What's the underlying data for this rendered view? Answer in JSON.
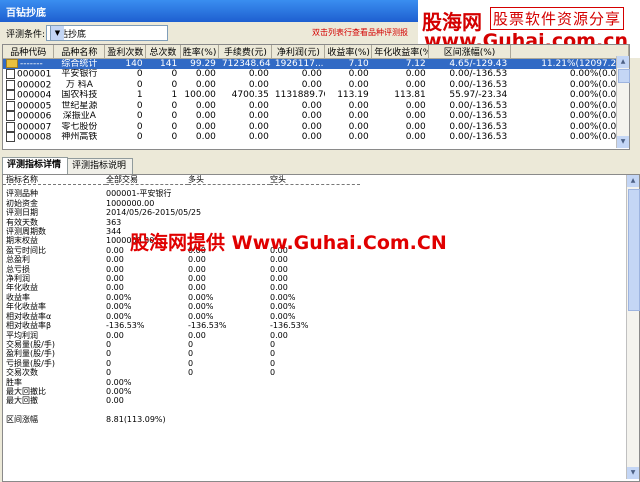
{
  "window": {
    "title": "百钻抄底"
  },
  "brand": {
    "logo": "股海网",
    "slogan": "股票软件资源分享",
    "url": "www.Guhai.com.cn"
  },
  "condition": {
    "label": "评测条件:",
    "value": "百钻抄底",
    "hint": "双击列表行查看品种评测报"
  },
  "grid": {
    "headers": [
      "品种代码",
      "品种名称",
      "盈利次数",
      "总次数",
      "胜率(%)",
      "手续费(元)",
      "净利润(元)",
      "收益率(%)",
      "年化收益率(%)",
      "区间涨幅(%)",
      ""
    ],
    "rows": [
      [
        "-------",
        "综合统计",
        "140",
        "141",
        "99.29",
        "712348.64",
        "1926117...",
        "7.10",
        "7.12",
        "4.65/-129.43",
        "11.21%(12097.25)"
      ],
      [
        "000001",
        "平安银行",
        "0",
        "0",
        "0.00",
        "0.00",
        "0.00",
        "0.00",
        "0.00",
        "0.00/-136.53",
        "0.00%(0.00)"
      ],
      [
        "000002",
        "万  科A",
        "0",
        "0",
        "0.00",
        "0.00",
        "0.00",
        "0.00",
        "0.00",
        "0.00/-136.53",
        "0.00%(0.00)"
      ],
      [
        "000004",
        "国农科技",
        "1",
        "1",
        "100.00",
        "4700.35",
        "1131889.76",
        "113.19",
        "113.81",
        "55.97/-23.34",
        "0.00%(0.00)"
      ],
      [
        "000005",
        "世纪星源",
        "0",
        "0",
        "0.00",
        "0.00",
        "0.00",
        "0.00",
        "0.00",
        "0.00/-136.53",
        "0.00%(0.00)"
      ],
      [
        "000006",
        "深振业A",
        "0",
        "0",
        "0.00",
        "0.00",
        "0.00",
        "0.00",
        "0.00",
        "0.00/-136.53",
        "0.00%(0.00)"
      ],
      [
        "000007",
        "零七股份",
        "0",
        "0",
        "0.00",
        "0.00",
        "0.00",
        "0.00",
        "0.00",
        "0.00/-136.53",
        "0.00%(0.00)"
      ],
      [
        "000008",
        "神州高铁",
        "0",
        "0",
        "0.00",
        "0.00",
        "0.00",
        "0.00",
        "0.00",
        "0.00/-136.53",
        "0.00%(0.00)"
      ]
    ]
  },
  "tabs": [
    "评测指标详情",
    "评测指标说明"
  ],
  "detail": {
    "headers": [
      "指标名称",
      "全部交易",
      "多头",
      "空头"
    ],
    "rows": [
      [
        "评测品种",
        "000001-平安银行",
        "",
        ""
      ],
      [
        "初始资金",
        "1000000.00",
        "",
        ""
      ],
      [
        "评测日期",
        "2014/05/26-2015/05/25",
        "",
        ""
      ],
      [
        "有效天数",
        "363",
        "",
        ""
      ],
      [
        "评测周期数",
        "344",
        "",
        ""
      ],
      [
        "期末权益",
        "1000000.00",
        "",
        ""
      ],
      [
        "盈亏时间比",
        "0.00",
        "0.00",
        "0.00"
      ],
      [
        "总盈利",
        "0.00",
        "0.00",
        "0.00"
      ],
      [
        "总亏损",
        "0.00",
        "0.00",
        "0.00"
      ],
      [
        "净利润",
        "0.00",
        "0.00",
        "0.00"
      ],
      [
        "年化收益",
        "0.00",
        "0.00",
        "0.00"
      ],
      [
        "收益率",
        "0.00%",
        "0.00%",
        "0.00%"
      ],
      [
        "年化收益率",
        "0.00%",
        "0.00%",
        "0.00%"
      ],
      [
        "相对收益率α",
        "0.00%",
        "0.00%",
        "0.00%"
      ],
      [
        "相对收益率β",
        "-136.53%",
        "-136.53%",
        "-136.53%"
      ],
      [
        "平均利润",
        "0.00",
        "0.00",
        "0.00"
      ],
      [
        "交易量(股/手)",
        "0",
        "0",
        "0"
      ],
      [
        "盈利量(股/手)",
        "0",
        "0",
        "0"
      ],
      [
        "亏损量(股/手)",
        "0",
        "0",
        "0"
      ],
      [
        "交易次数",
        "0",
        "0",
        "0"
      ],
      [
        "胜率",
        "0.00%",
        "",
        ""
      ],
      [
        "最大回撤比",
        "0.00%",
        "",
        ""
      ],
      [
        "最大回撤",
        "0.00",
        "",
        ""
      ],
      [
        "",
        "",
        "",
        ""
      ],
      [
        "区间涨幅",
        "8.81(113.09%)",
        "",
        ""
      ]
    ]
  },
  "watermark": "股海网提供 Www.Guhai.Com.CN"
}
